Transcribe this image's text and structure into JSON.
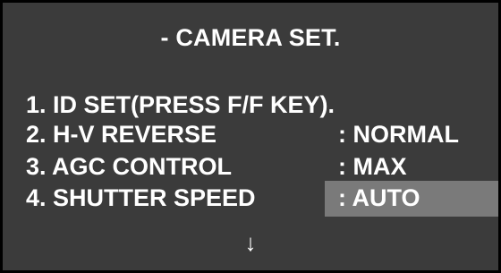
{
  "osd": {
    "title": "- CAMERA SET.",
    "items": [
      {
        "label": "1. ID SET(PRESS F/F KEY).",
        "value": ""
      },
      {
        "label": "2. H-V REVERSE",
        "value": ": NORMAL"
      },
      {
        "label": "3. AGC CONTROL",
        "value": ": MAX"
      },
      {
        "label": "4. SHUTTER SPEED",
        "value": ": AUTO"
      }
    ],
    "scroll_indicator": "↓",
    "selected_index": 3
  },
  "colors": {
    "background": "#3b3b3b",
    "border": "#000000",
    "text": "#ffffff",
    "selection_highlight": "#7a7a7a"
  },
  "icons": {
    "scroll_indicator": "down-arrow-icon"
  }
}
